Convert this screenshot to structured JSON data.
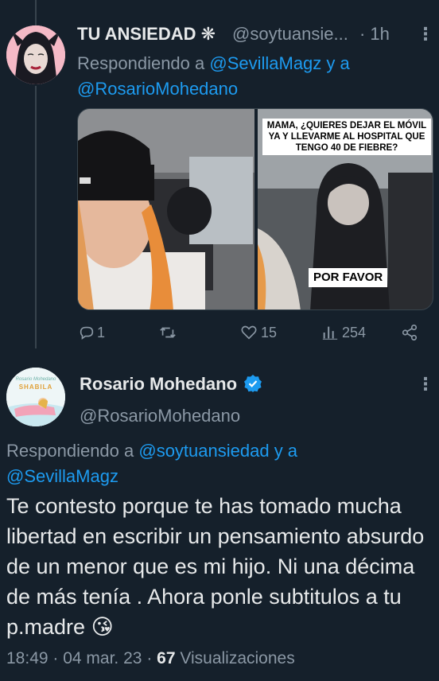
{
  "tweet1": {
    "display_name": "TU ANSIEDAD",
    "name_emoji": "❋",
    "handle": "@soytuansie...",
    "time": "· 1h",
    "more": "⋮",
    "reply_prefix": "Respondiendo a ",
    "reply_user1": "@SevillaMagz",
    "reply_and": " y a",
    "reply_user2": "@RosarioMohedano",
    "meme_text_top": "MAMA, ¿QUIERES DEJAR EL MÓVIL YA Y LLEVARME AL HOSPITAL QUE TENGO 40 DE FIEBRE?",
    "meme_text_bottom": "POR FAVOR",
    "actions": {
      "replies": "1",
      "retweets": "",
      "likes": "15",
      "views": "254"
    }
  },
  "tweet2": {
    "display_name": "Rosario Mohedano",
    "verified": true,
    "handle": "@RosarioMohedano",
    "more": "⋮",
    "reply_prefix": "Respondiendo a ",
    "reply_user1": "@soytuansiedad",
    "reply_and": " y a",
    "reply_user2": "@SevillaMagz",
    "body": "Te contesto porque te has tomado mucha libertad en escribir un pensamiento absurdo de un menor que es mi hijo. Ni una décima de más tenía . Ahora ponle subtitulos a tu p.madre",
    "emoji": "😘",
    "time": "18:49",
    "date": "04 mar. 23",
    "views_count": "67",
    "views_label": "Visualizaciones",
    "avatar_text_top": "Rosario Mohedano",
    "avatar_text_brand": "SHABILA"
  },
  "colors": {
    "background": "#15202b",
    "text": "#e7e9ea",
    "muted": "#8b98a5",
    "link": "#1d9bf0",
    "verified": "#1d9bf0"
  }
}
